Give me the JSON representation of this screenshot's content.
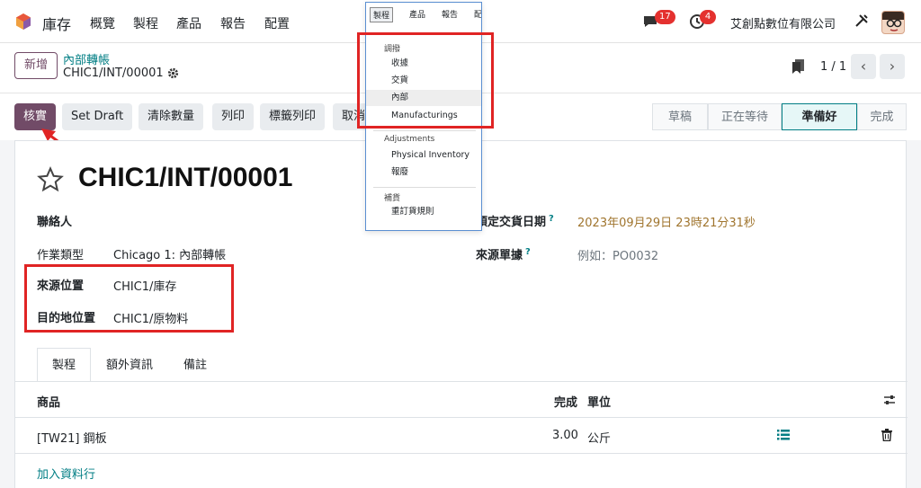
{
  "navbar": {
    "app_name": "庫存",
    "menus": [
      "概覽",
      "製程",
      "產品",
      "報告",
      "配置"
    ],
    "chat_count": "17",
    "activity_count": "4",
    "company": "艾創點數位有限公司"
  },
  "control": {
    "new_label": "新增",
    "breadcrumb_parent": "內部轉帳",
    "breadcrumb_current": "CHIC1/INT/00001",
    "pager": "1 / 1"
  },
  "actions": {
    "validate": "核實",
    "set_draft": "Set Draft",
    "clear_qty": "清除數量",
    "print": "列印",
    "print_labels": "標籤列印",
    "cancel": "取消"
  },
  "status": {
    "stages": [
      "草稿",
      "正在等待",
      "準備好",
      "完成"
    ],
    "active": "準備好"
  },
  "form": {
    "title": "CHIC1/INT/00001",
    "contact_label": "聯絡人",
    "op_type_label": "作業類型",
    "op_type_value": "Chicago 1: 內部轉帳",
    "src_label": "來源位置",
    "src_value": "CHIC1/庫存",
    "dest_label": "目的地位置",
    "dest_value": "CHIC1/原物料",
    "sched_label": "預定交貨日期",
    "sched_value": "2023年09月29日 23時21分31秒",
    "origin_label": "來源單據",
    "origin_placeholder": "例如：PO0032",
    "help": "?"
  },
  "tabs": [
    "製程",
    "額外資訊",
    "備註"
  ],
  "table": {
    "headers": {
      "product": "商品",
      "done": "完成",
      "uom": "單位"
    },
    "rows": [
      {
        "product": "[TW21] 鋼板",
        "done": "3.00",
        "uom": "公斤"
      }
    ],
    "add_line": "加入資料行"
  },
  "dropdown": {
    "bar": [
      "製程",
      "產品",
      "報告",
      "配"
    ],
    "sections": [
      {
        "title": "調撥",
        "items": [
          "收據",
          "交貨",
          "內部",
          "Manufacturings"
        ]
      },
      {
        "title": "Adjustments",
        "items": [
          "Physical Inventory",
          "報廢"
        ]
      },
      {
        "title": "補貨",
        "items": [
          "重訂貨規則"
        ]
      }
    ],
    "highlighted": "內部"
  },
  "colors": {
    "brand": "#714b67",
    "link": "#017e84",
    "annotation": "#e02424"
  }
}
